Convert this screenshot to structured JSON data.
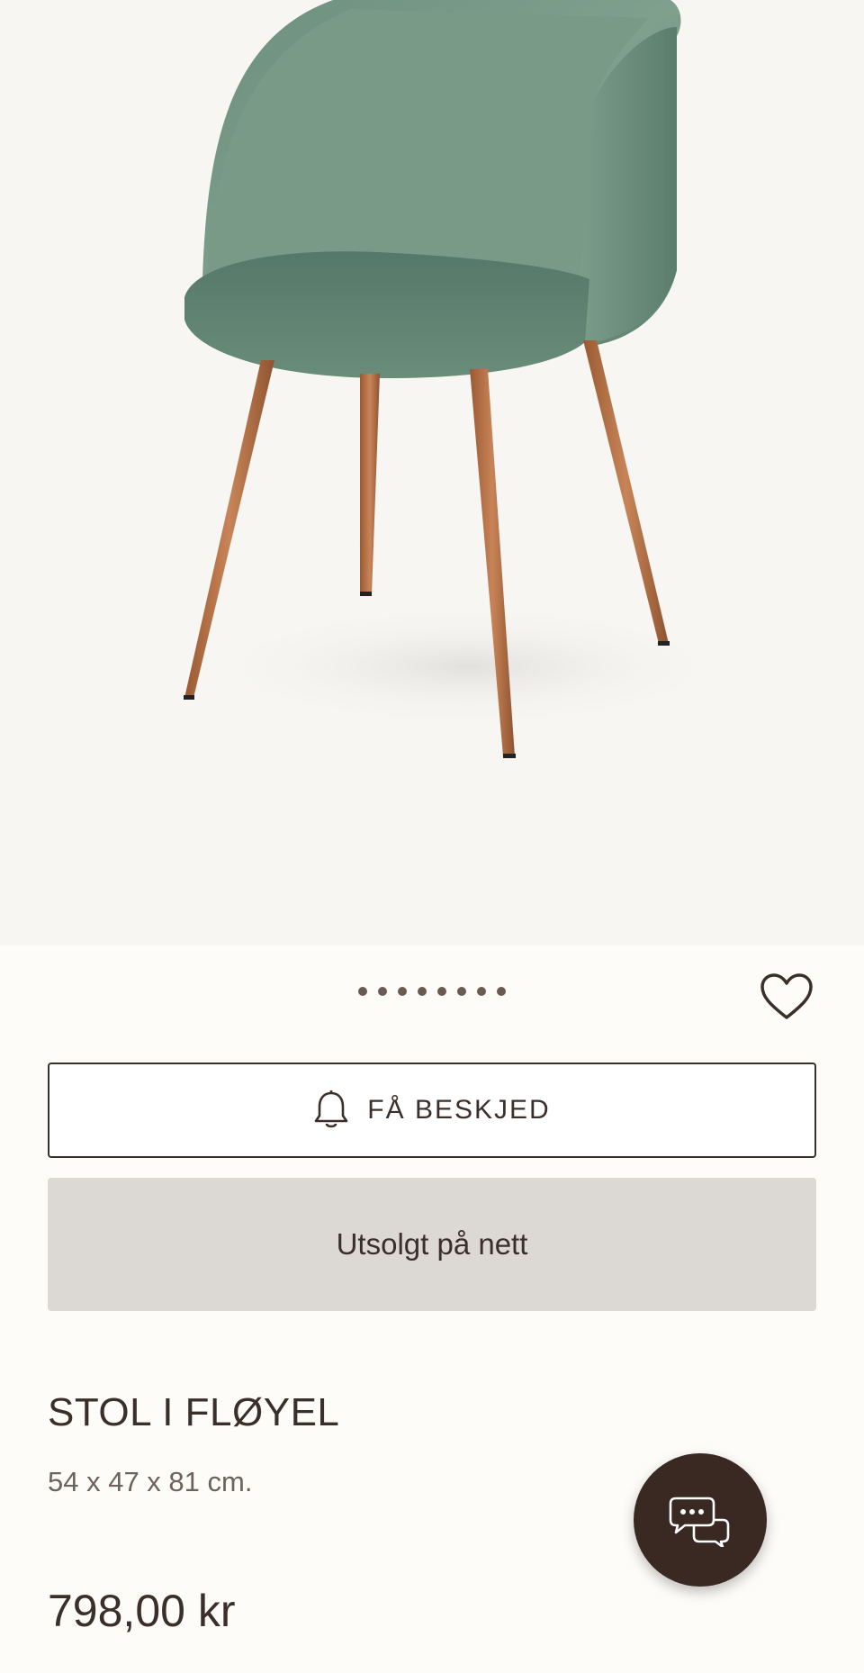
{
  "gallery": {
    "image_alt": "Green velvet chair with wooden legs",
    "dots_count": 8
  },
  "actions": {
    "notify_label": "FÅ BESKJED",
    "soldout_label": "Utsolgt på nett"
  },
  "product": {
    "title": "STOL I FLØYEL",
    "dimensions": "54 x 47 x 81 cm.",
    "price": "798,00 kr"
  },
  "icons": {
    "favorite": "heart-icon",
    "notify": "bell-icon",
    "chat": "chat-bubbles-icon"
  },
  "colors": {
    "brand_dark": "#3a2823",
    "text": "#3b2f2a",
    "soldout_bg": "#dcd9d5",
    "chair_velvet": "#6f9581",
    "chair_legs": "#b36f42"
  }
}
